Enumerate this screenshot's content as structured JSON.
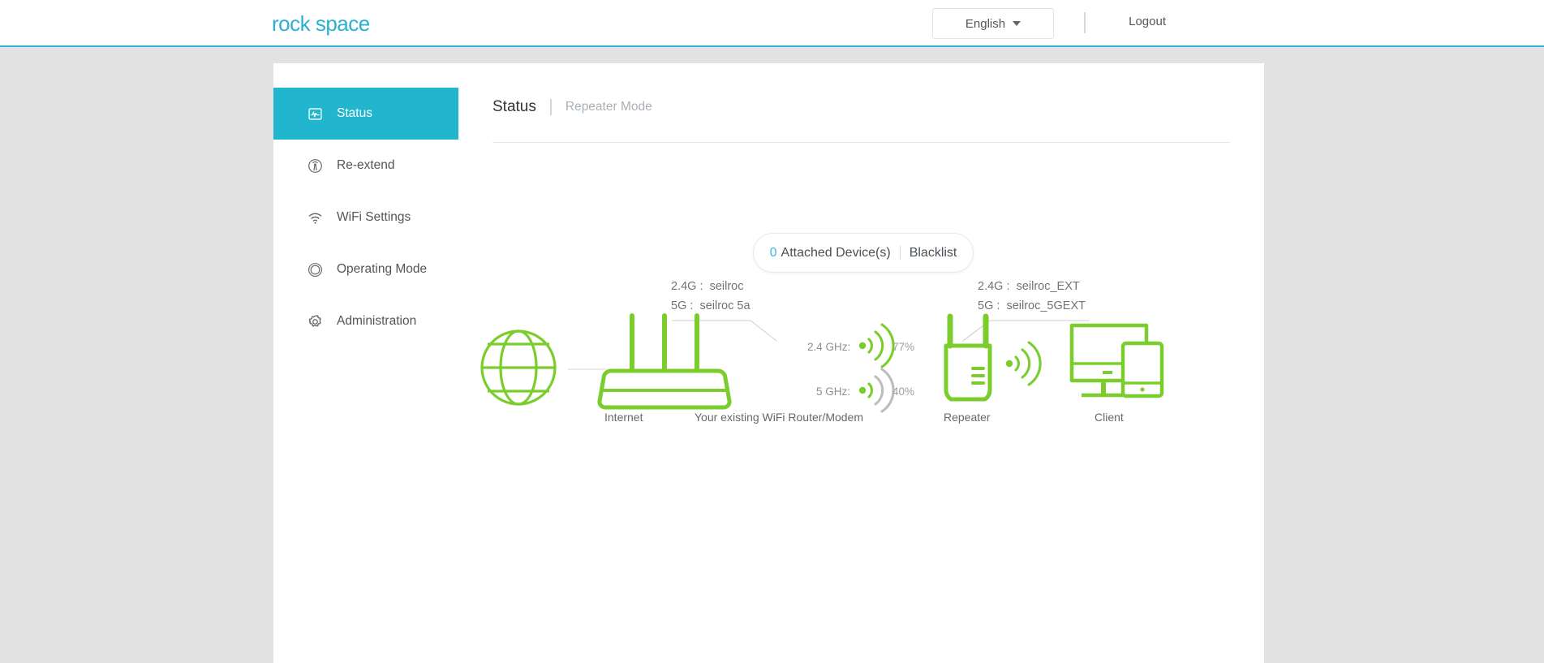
{
  "header": {
    "logo_text": "rock space",
    "language": "English",
    "logout_label": "Logout"
  },
  "sidebar": {
    "items": [
      {
        "label": "Status",
        "icon": "status-chart-icon",
        "active": true
      },
      {
        "label": "Re-extend",
        "icon": "broadcast-icon",
        "active": false
      },
      {
        "label": "WiFi Settings",
        "icon": "wifi-icon",
        "active": false
      },
      {
        "label": "Operating Mode",
        "icon": "circles-icon",
        "active": false
      },
      {
        "label": "Administration",
        "icon": "gear-icon",
        "active": false
      }
    ]
  },
  "breadcrumb": {
    "title": "Status",
    "mode": "Repeater Mode"
  },
  "devices_pill": {
    "count": "0",
    "label": "Attached Device(s)",
    "blacklist_label": "Blacklist"
  },
  "diagram": {
    "router_ssid": {
      "band_24_key": "2.4G :",
      "band_24_value": "seilroc",
      "band_5_key": "5G :",
      "band_5_value": "seilroc 5a"
    },
    "repeater_ssid": {
      "band_24_key": "2.4G :",
      "band_24_value": "seilroc_EXT",
      "band_5_key": "5G :",
      "band_5_value": "seilroc_5GEXT"
    },
    "signals": [
      {
        "band_label": "2.4 GHz:",
        "percent": "77%",
        "bars": 3
      },
      {
        "band_label": "5 GHz:",
        "percent": "40%",
        "bars": 1
      }
    ],
    "nodes": [
      {
        "label": "Internet",
        "icon": "globe-icon"
      },
      {
        "label": "Your existing WiFi Router/Modem",
        "icon": "router-icon"
      },
      {
        "label": "Repeater",
        "icon": "wall-plug-extender-icon"
      },
      {
        "label": "Client",
        "icon": "monitor-tablet-icon"
      }
    ]
  },
  "colors": {
    "brand": "#21b6ce",
    "logo": "#29b0d2",
    "green": "#77cd2b",
    "gray_signal": "#b8b8b8",
    "page_bg": "#e2e2e2"
  }
}
